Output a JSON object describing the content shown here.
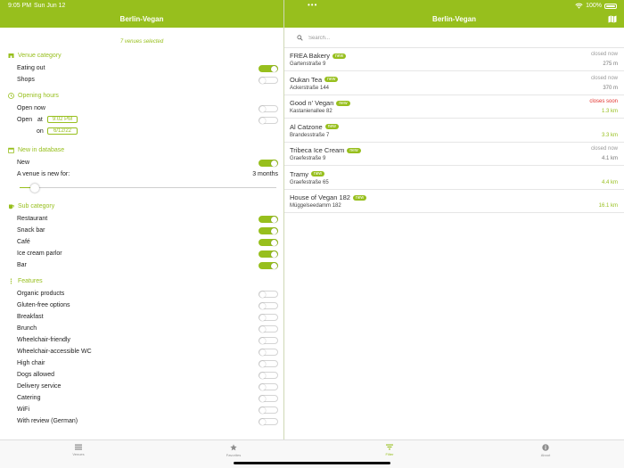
{
  "status_bar": {
    "time": "9:05 PM",
    "date": "Sun Jun 12",
    "battery": "100%"
  },
  "nav": {
    "left_title": "Berlin-Vegan",
    "right_title": "Berlin-Vegan",
    "map_icon": "map-icon"
  },
  "filters": {
    "selected_text": "7 venues selected",
    "venue_category": {
      "title": "Venue category",
      "items": [
        {
          "label": "Eating out",
          "on": true
        },
        {
          "label": "Shops",
          "on": false
        }
      ]
    },
    "opening_hours": {
      "title": "Opening hours",
      "open_now": {
        "label": "Open now",
        "on": false
      },
      "open_at": {
        "label": "Open",
        "at_label": "at",
        "time": "9:02 PM",
        "on_label": "on",
        "date": "6/12/22",
        "on": false
      }
    },
    "new_in_database": {
      "title": "New in database",
      "new_toggle": {
        "label": "New",
        "on": true
      },
      "new_for_label": "A venue is new for:",
      "new_for_value": "3 months",
      "slider_fraction": 0.06
    },
    "sub_category": {
      "title": "Sub category",
      "items": [
        {
          "label": "Restaurant",
          "on": true
        },
        {
          "label": "Snack bar",
          "on": true
        },
        {
          "label": "Café",
          "on": true
        },
        {
          "label": "Ice cream parlor",
          "on": true
        },
        {
          "label": "Bar",
          "on": true
        }
      ]
    },
    "features": {
      "title": "Features",
      "items": [
        {
          "label": "Organic products",
          "on": false
        },
        {
          "label": "Gluten-free options",
          "on": false
        },
        {
          "label": "Breakfast",
          "on": false
        },
        {
          "label": "Brunch",
          "on": false
        },
        {
          "label": "Wheelchair-friendly",
          "on": false
        },
        {
          "label": "Wheelchair-accessible WC",
          "on": false
        },
        {
          "label": "High chair",
          "on": false
        },
        {
          "label": "Dogs allowed",
          "on": false
        },
        {
          "label": "Delivery service",
          "on": false
        },
        {
          "label": "Catering",
          "on": false
        },
        {
          "label": "WiFi",
          "on": false
        },
        {
          "label": "With review (German)",
          "on": false
        }
      ]
    }
  },
  "search": {
    "placeholder": "Search..."
  },
  "venues": [
    {
      "name": "FREA Bakery",
      "badge": "new",
      "street": "Gartenstraße 9",
      "status": "closed now",
      "status_type": "closed",
      "distance": "275 m",
      "distance_green": false
    },
    {
      "name": "Oukan Tea",
      "badge": "new",
      "street": "Ackerstraße 144",
      "status": "closed now",
      "status_type": "closed",
      "distance": "370 m",
      "distance_green": false
    },
    {
      "name": "Good n' Vegan",
      "badge": "new",
      "street": "Kastanienallee 82",
      "status": "closes soon",
      "status_type": "soon",
      "distance": "1.3 km",
      "distance_green": true
    },
    {
      "name": "Al Catzone",
      "badge": "new",
      "street": "Brandesstraße 7",
      "status": "",
      "status_type": "open",
      "distance": "3.3 km",
      "distance_green": true
    },
    {
      "name": "Tribeca Ice Cream",
      "badge": "new",
      "street": "Graefestraße 9",
      "status": "closed now",
      "status_type": "closed",
      "distance": "4.1 km",
      "distance_green": false
    },
    {
      "name": "Tramy",
      "badge": "new",
      "street": "Graefestraße 65",
      "status": "",
      "status_type": "open",
      "distance": "4.4 km",
      "distance_green": true
    },
    {
      "name": "House of Vegan 182",
      "badge": "new",
      "street": "Müggelseedamm 182",
      "status": "",
      "status_type": "open",
      "distance": "16.1 km",
      "distance_green": true
    }
  ],
  "tabs": [
    {
      "label": "Venues",
      "icon": "list-icon",
      "active": false
    },
    {
      "label": "Favorites",
      "icon": "star-icon",
      "active": false
    },
    {
      "label": "Filter",
      "icon": "filter-icon",
      "active": true
    },
    {
      "label": "About",
      "icon": "info-icon",
      "active": false
    }
  ],
  "colors": {
    "accent": "#97bf1d",
    "closes_soon": "#e2312c",
    "muted": "#9a9a9a"
  }
}
